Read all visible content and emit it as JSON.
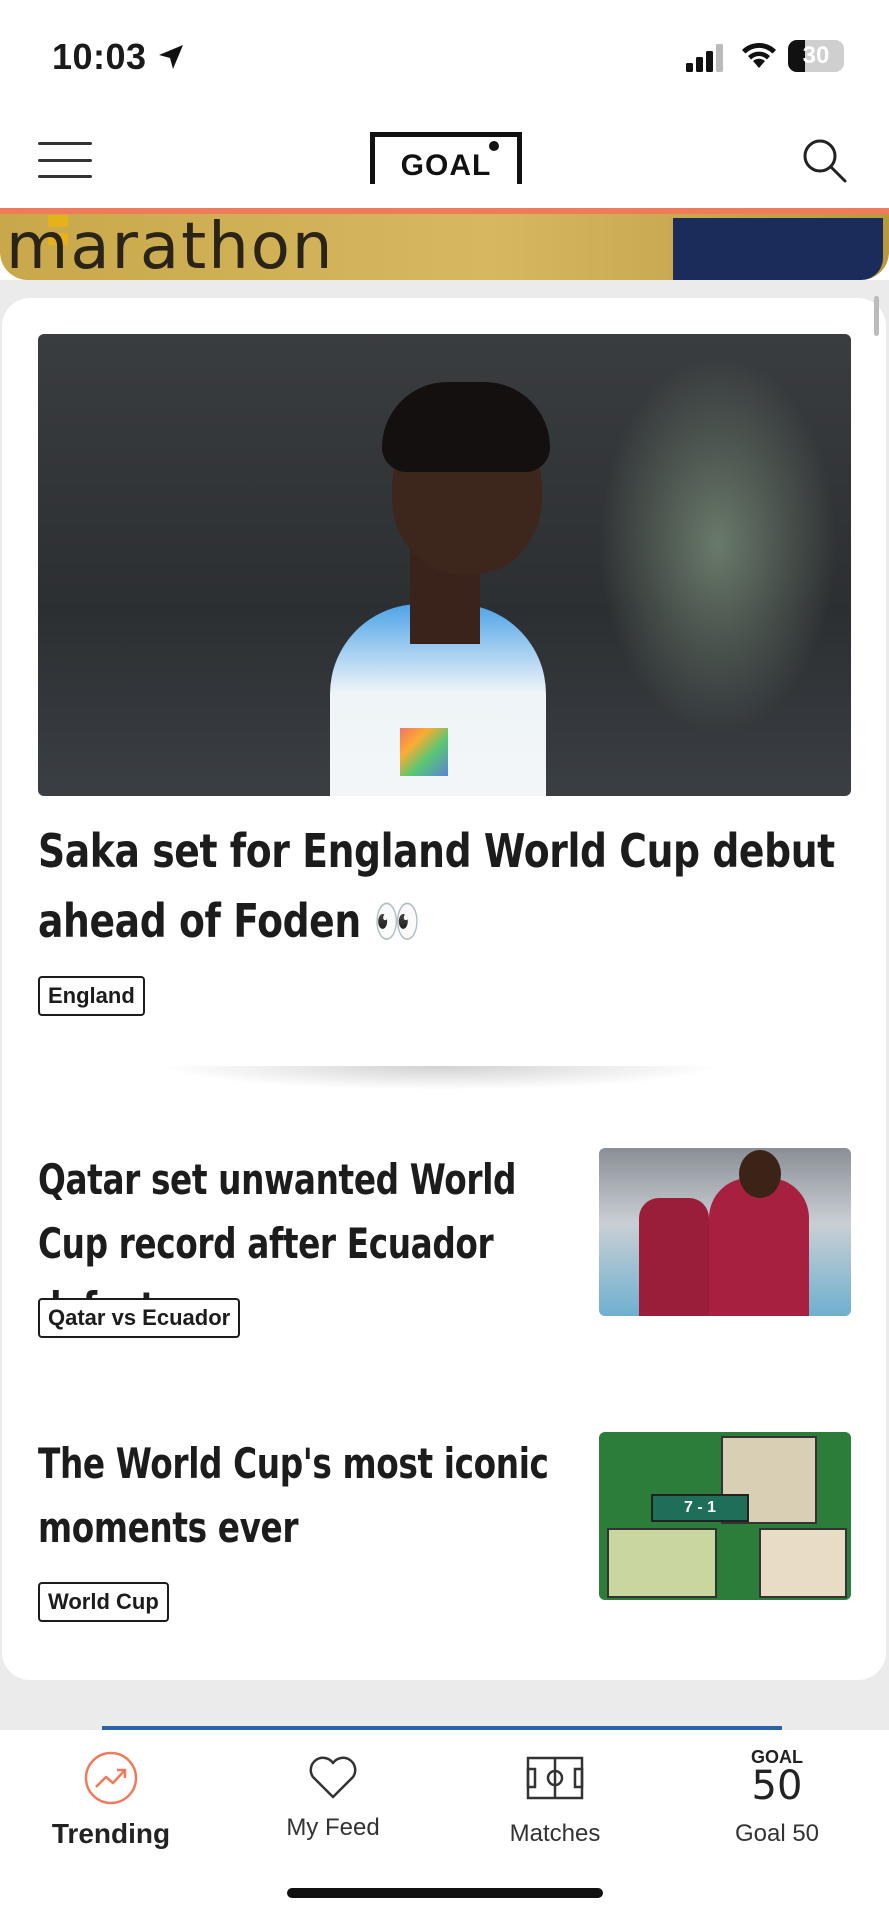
{
  "status_bar": {
    "time": "10:03",
    "battery": "30"
  },
  "header": {
    "logo_text": "GOAL",
    "menu_icon": "hamburger-menu-icon",
    "search_icon": "search-icon"
  },
  "promo": {
    "text": "marathon"
  },
  "articles": [
    {
      "headline": "Saka set for England World Cup debut ahead of Foden 👀",
      "tag": "England"
    },
    {
      "headline": "Qatar set unwanted World Cup record after Ecuador defeat",
      "tag": "Qatar vs Ecuador"
    },
    {
      "headline": "The World Cup's most iconic moments ever",
      "tag": "World Cup",
      "thumb_score": "7 - 1"
    }
  ],
  "tabs": [
    {
      "label": "Trending",
      "icon": "trending-icon",
      "active": true
    },
    {
      "label": "My Feed",
      "icon": "heart-icon",
      "active": false
    },
    {
      "label": "Matches",
      "icon": "pitch-icon",
      "active": false
    },
    {
      "label": "Goal 50",
      "icon": "goal50-icon",
      "active": false,
      "icon_text_top": "GOAL",
      "icon_text_num": "50"
    }
  ],
  "colors": {
    "accent": "#f07a5a",
    "text": "#1c1c1c"
  }
}
